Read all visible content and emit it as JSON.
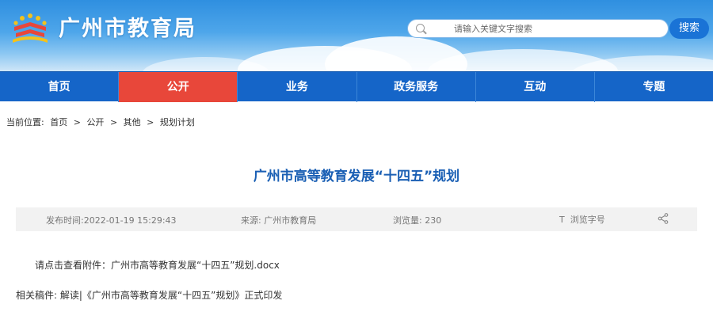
{
  "header": {
    "site_title": "广州市教育局",
    "logo_icon": "education-bureau-emblem-icon",
    "search_placeholder": "请输入关键文字搜索",
    "search_button": "搜索"
  },
  "nav": {
    "items": [
      {
        "label": "首页",
        "active": false
      },
      {
        "label": "公开",
        "active": true
      },
      {
        "label": "业务",
        "active": false
      },
      {
        "label": "政务服务",
        "active": false
      },
      {
        "label": "互动",
        "active": false
      },
      {
        "label": "专题",
        "active": false
      }
    ],
    "active_color": "#e8473a",
    "bar_color": "#1565c8"
  },
  "breadcrumb": {
    "prefix": "当前位置:",
    "items": [
      "首页",
      ">",
      "公开",
      ">",
      "其他",
      ">",
      "规划计划"
    ]
  },
  "article": {
    "title": "广州市高等教育发展“十四五”规划",
    "publish_time": "发布时间:2022-01-19 15:29:43",
    "source": "来源: 广州市教育局",
    "views": "浏览量: 230",
    "font_size_label": "浏览字号",
    "attachment": "请点击查看附件：广州市高等教育发展“十四五”规划.docx",
    "related": "相关稿件: 解读|《广州市高等教育发展“十四五”规划》正式印发"
  }
}
